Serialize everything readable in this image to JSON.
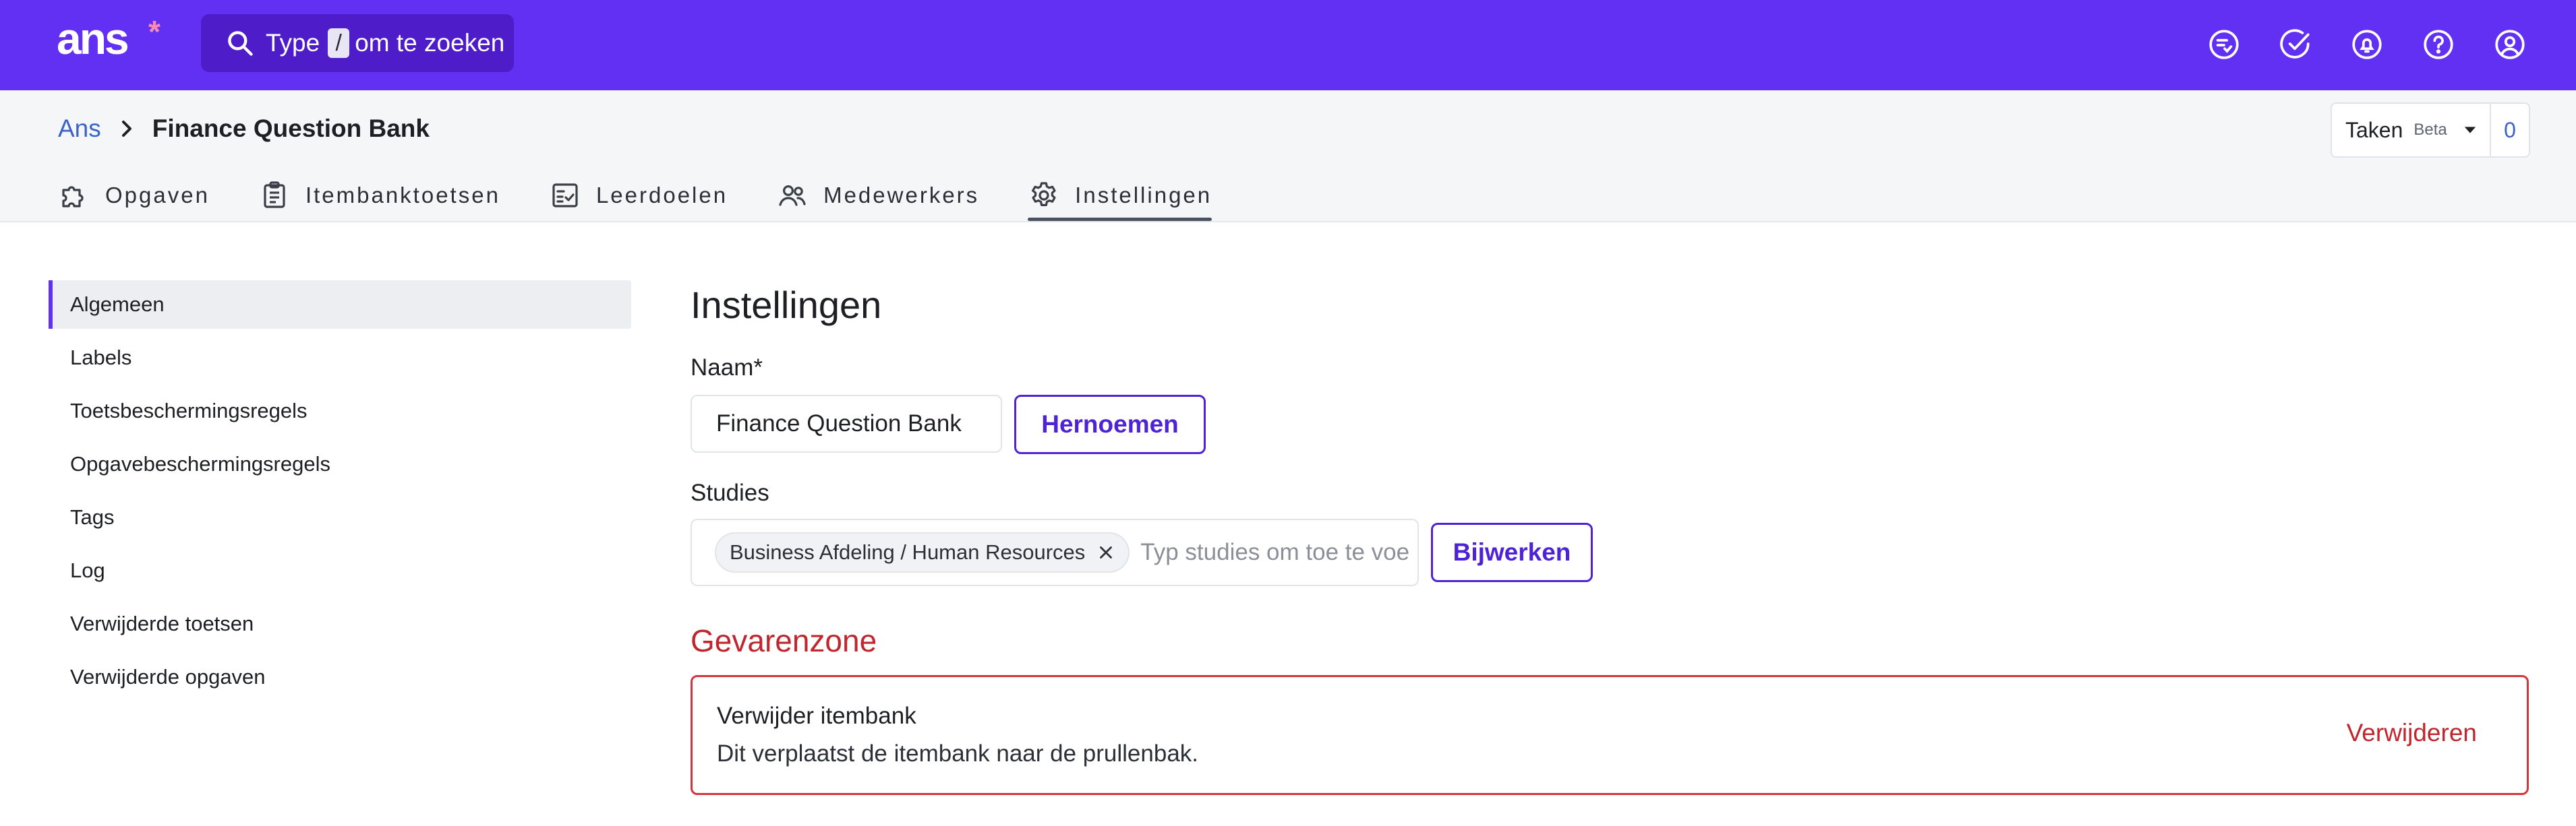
{
  "app": {
    "logo_text": "ans",
    "logo_star": "*",
    "colors": {
      "brand": "#6230f2",
      "brand_dark": "#4e1dc9",
      "accent": "#4e23d6",
      "danger": "#c0262d",
      "link": "#3a63c8"
    }
  },
  "search": {
    "prefix": "Type",
    "key": "/",
    "suffix": "om te zoeken",
    "icon": "search-icon"
  },
  "top_icons": [
    "tasks-icon",
    "check-circle-icon",
    "notification-bell-icon",
    "help-icon",
    "user-account-icon"
  ],
  "breadcrumb": {
    "root": "Ans",
    "current": "Finance Question Bank"
  },
  "taken": {
    "label": "Taken",
    "badge": "Beta",
    "count": "0"
  },
  "tabs": [
    {
      "label": "Opgaven",
      "icon": "puzzle-icon"
    },
    {
      "label": "Itembanktoetsen",
      "icon": "clipboard-icon"
    },
    {
      "label": "Leerdoelen",
      "icon": "checklist-icon"
    },
    {
      "label": "Medewerkers",
      "icon": "users-icon"
    },
    {
      "label": "Instellingen",
      "icon": "gear-icon",
      "active": true
    }
  ],
  "sidenav": {
    "items": [
      {
        "label": "Algemeen",
        "active": true
      },
      {
        "label": "Labels"
      },
      {
        "label": "Toetsbeschermingsregels"
      },
      {
        "label": "Opgavebeschermingsregels"
      },
      {
        "label": "Tags"
      },
      {
        "label": "Log"
      },
      {
        "label": "Verwijderde toetsen"
      },
      {
        "label": "Verwijderde opgaven"
      }
    ]
  },
  "main": {
    "title": "Instellingen",
    "name_label": "Naam*",
    "name_value": "Finance Question Bank",
    "rename_button": "Hernoemen",
    "studies_label": "Studies",
    "studies_chip": "Business Afdeling / Human Resources",
    "studies_placeholder": "Typ studies om toe te voegen",
    "update_button": "Bijwerken",
    "danger_title": "Gevarenzone",
    "danger_item_title": "Verwijder itembank",
    "danger_item_desc": "Dit verplaatst de itembank naar de prullenbak.",
    "danger_button": "Verwijderen"
  }
}
